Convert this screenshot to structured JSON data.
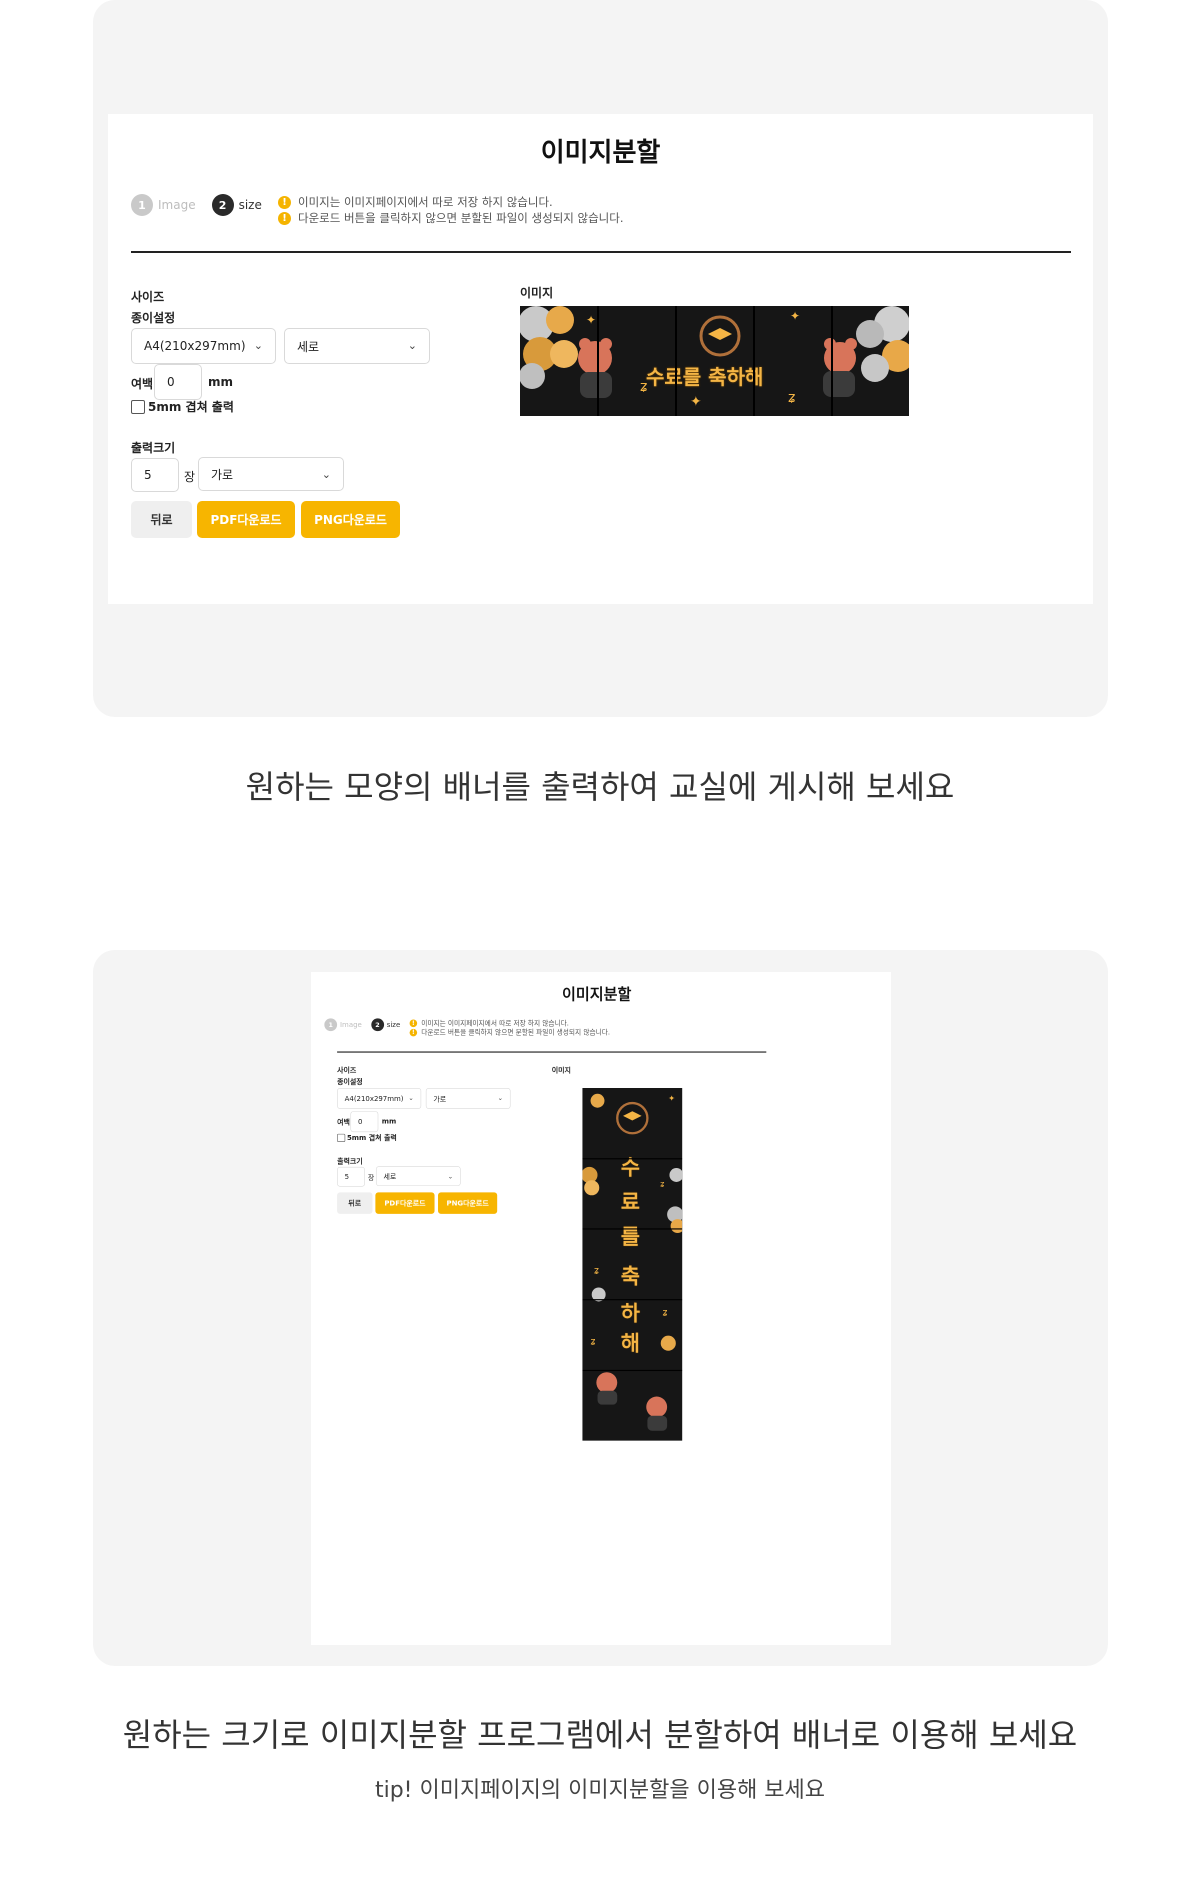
{
  "screens": [
    {
      "title": "이미지분할",
      "steps": [
        {
          "num": "1",
          "label": "Image"
        },
        {
          "num": "2",
          "label": "size"
        }
      ],
      "notices": [
        "이미지는 이미지페이지에서 따로 저장 하지 않습니다.",
        "다운로드 버튼을 클릭하지 않으면 분할된 파일이 생성되지 않습니다."
      ],
      "size_section": "사이즈",
      "paper_label": "종이설정",
      "paper_size": "A4(210x297mm)",
      "orientation": "세로",
      "margin_label": "여백",
      "margin_value": "0",
      "margin_unit": "mm",
      "overlap_label": "5mm 겹쳐 출력",
      "output_label": "출력크기",
      "output_count": "5",
      "output_unit": "장",
      "output_direction": "가로",
      "back_button": "뒤로",
      "pdf_button": "PDF다운로드",
      "png_button": "PNG다운로드",
      "image_label": "이미지",
      "banner_text": "수료를 축하해"
    },
    {
      "title": "이미지분할",
      "steps": [
        {
          "num": "1",
          "label": "Image"
        },
        {
          "num": "2",
          "label": "size"
        }
      ],
      "notices": [
        "이미지는 이미지페이지에서 따로 저장 하지 않습니다.",
        "다운로드 버튼을 클릭하지 않으면 분할된 파일이 생성되지 않습니다."
      ],
      "size_section": "사이즈",
      "paper_label": "종이설정",
      "paper_size": "A4(210x297mm)",
      "orientation": "가로",
      "margin_label": "여백",
      "margin_value": "0",
      "margin_unit": "mm",
      "overlap_label": "5mm 겹쳐 출력",
      "output_label": "출력크기",
      "output_count": "5",
      "output_unit": "장",
      "output_direction": "세로",
      "back_button": "뒤로",
      "pdf_button": "PDF다운로드",
      "png_button": "PNG다운로드",
      "image_label": "이미지",
      "banner_chars": [
        "수",
        "료",
        "를",
        "축",
        "하",
        "해"
      ]
    }
  ],
  "captions": {
    "first": "원하는 모양의 배너를 출력하여 교실에 게시해 보세요",
    "second": "원하는 크기로 이미지분할 프로그램에서 분할하여 배너로 이용해 보세요",
    "tip": "tip! 이미지페이지의 이미지분할을 이용해 보세요"
  },
  "colors": {
    "accent": "#f7b500",
    "panel_bg": "#f4f4f4",
    "banner_bg": "#161616",
    "banner_text": "#f4b545"
  }
}
